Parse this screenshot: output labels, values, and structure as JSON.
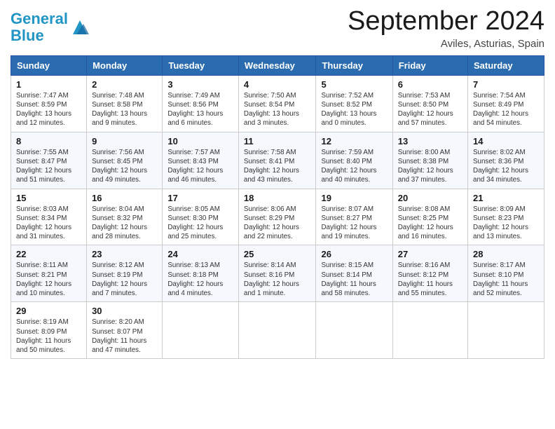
{
  "header": {
    "logo_line1": "General",
    "logo_line2": "Blue",
    "month": "September 2024",
    "location": "Aviles, Asturias, Spain"
  },
  "weekdays": [
    "Sunday",
    "Monday",
    "Tuesday",
    "Wednesday",
    "Thursday",
    "Friday",
    "Saturday"
  ],
  "weeks": [
    [
      {
        "num": "1",
        "sunrise": "Sunrise: 7:47 AM",
        "sunset": "Sunset: 8:59 PM",
        "daylight": "Daylight: 13 hours and 12 minutes."
      },
      {
        "num": "2",
        "sunrise": "Sunrise: 7:48 AM",
        "sunset": "Sunset: 8:58 PM",
        "daylight": "Daylight: 13 hours and 9 minutes."
      },
      {
        "num": "3",
        "sunrise": "Sunrise: 7:49 AM",
        "sunset": "Sunset: 8:56 PM",
        "daylight": "Daylight: 13 hours and 6 minutes."
      },
      {
        "num": "4",
        "sunrise": "Sunrise: 7:50 AM",
        "sunset": "Sunset: 8:54 PM",
        "daylight": "Daylight: 13 hours and 3 minutes."
      },
      {
        "num": "5",
        "sunrise": "Sunrise: 7:52 AM",
        "sunset": "Sunset: 8:52 PM",
        "daylight": "Daylight: 13 hours and 0 minutes."
      },
      {
        "num": "6",
        "sunrise": "Sunrise: 7:53 AM",
        "sunset": "Sunset: 8:50 PM",
        "daylight": "Daylight: 12 hours and 57 minutes."
      },
      {
        "num": "7",
        "sunrise": "Sunrise: 7:54 AM",
        "sunset": "Sunset: 8:49 PM",
        "daylight": "Daylight: 12 hours and 54 minutes."
      }
    ],
    [
      {
        "num": "8",
        "sunrise": "Sunrise: 7:55 AM",
        "sunset": "Sunset: 8:47 PM",
        "daylight": "Daylight: 12 hours and 51 minutes."
      },
      {
        "num": "9",
        "sunrise": "Sunrise: 7:56 AM",
        "sunset": "Sunset: 8:45 PM",
        "daylight": "Daylight: 12 hours and 49 minutes."
      },
      {
        "num": "10",
        "sunrise": "Sunrise: 7:57 AM",
        "sunset": "Sunset: 8:43 PM",
        "daylight": "Daylight: 12 hours and 46 minutes."
      },
      {
        "num": "11",
        "sunrise": "Sunrise: 7:58 AM",
        "sunset": "Sunset: 8:41 PM",
        "daylight": "Daylight: 12 hours and 43 minutes."
      },
      {
        "num": "12",
        "sunrise": "Sunrise: 7:59 AM",
        "sunset": "Sunset: 8:40 PM",
        "daylight": "Daylight: 12 hours and 40 minutes."
      },
      {
        "num": "13",
        "sunrise": "Sunrise: 8:00 AM",
        "sunset": "Sunset: 8:38 PM",
        "daylight": "Daylight: 12 hours and 37 minutes."
      },
      {
        "num": "14",
        "sunrise": "Sunrise: 8:02 AM",
        "sunset": "Sunset: 8:36 PM",
        "daylight": "Daylight: 12 hours and 34 minutes."
      }
    ],
    [
      {
        "num": "15",
        "sunrise": "Sunrise: 8:03 AM",
        "sunset": "Sunset: 8:34 PM",
        "daylight": "Daylight: 12 hours and 31 minutes."
      },
      {
        "num": "16",
        "sunrise": "Sunrise: 8:04 AM",
        "sunset": "Sunset: 8:32 PM",
        "daylight": "Daylight: 12 hours and 28 minutes."
      },
      {
        "num": "17",
        "sunrise": "Sunrise: 8:05 AM",
        "sunset": "Sunset: 8:30 PM",
        "daylight": "Daylight: 12 hours and 25 minutes."
      },
      {
        "num": "18",
        "sunrise": "Sunrise: 8:06 AM",
        "sunset": "Sunset: 8:29 PM",
        "daylight": "Daylight: 12 hours and 22 minutes."
      },
      {
        "num": "19",
        "sunrise": "Sunrise: 8:07 AM",
        "sunset": "Sunset: 8:27 PM",
        "daylight": "Daylight: 12 hours and 19 minutes."
      },
      {
        "num": "20",
        "sunrise": "Sunrise: 8:08 AM",
        "sunset": "Sunset: 8:25 PM",
        "daylight": "Daylight: 12 hours and 16 minutes."
      },
      {
        "num": "21",
        "sunrise": "Sunrise: 8:09 AM",
        "sunset": "Sunset: 8:23 PM",
        "daylight": "Daylight: 12 hours and 13 minutes."
      }
    ],
    [
      {
        "num": "22",
        "sunrise": "Sunrise: 8:11 AM",
        "sunset": "Sunset: 8:21 PM",
        "daylight": "Daylight: 12 hours and 10 minutes."
      },
      {
        "num": "23",
        "sunrise": "Sunrise: 8:12 AM",
        "sunset": "Sunset: 8:19 PM",
        "daylight": "Daylight: 12 hours and 7 minutes."
      },
      {
        "num": "24",
        "sunrise": "Sunrise: 8:13 AM",
        "sunset": "Sunset: 8:18 PM",
        "daylight": "Daylight: 12 hours and 4 minutes."
      },
      {
        "num": "25",
        "sunrise": "Sunrise: 8:14 AM",
        "sunset": "Sunset: 8:16 PM",
        "daylight": "Daylight: 12 hours and 1 minute."
      },
      {
        "num": "26",
        "sunrise": "Sunrise: 8:15 AM",
        "sunset": "Sunset: 8:14 PM",
        "daylight": "Daylight: 11 hours and 58 minutes."
      },
      {
        "num": "27",
        "sunrise": "Sunrise: 8:16 AM",
        "sunset": "Sunset: 8:12 PM",
        "daylight": "Daylight: 11 hours and 55 minutes."
      },
      {
        "num": "28",
        "sunrise": "Sunrise: 8:17 AM",
        "sunset": "Sunset: 8:10 PM",
        "daylight": "Daylight: 11 hours and 52 minutes."
      }
    ],
    [
      {
        "num": "29",
        "sunrise": "Sunrise: 8:19 AM",
        "sunset": "Sunset: 8:09 PM",
        "daylight": "Daylight: 11 hours and 50 minutes."
      },
      {
        "num": "30",
        "sunrise": "Sunrise: 8:20 AM",
        "sunset": "Sunset: 8:07 PM",
        "daylight": "Daylight: 11 hours and 47 minutes."
      },
      null,
      null,
      null,
      null,
      null
    ]
  ]
}
